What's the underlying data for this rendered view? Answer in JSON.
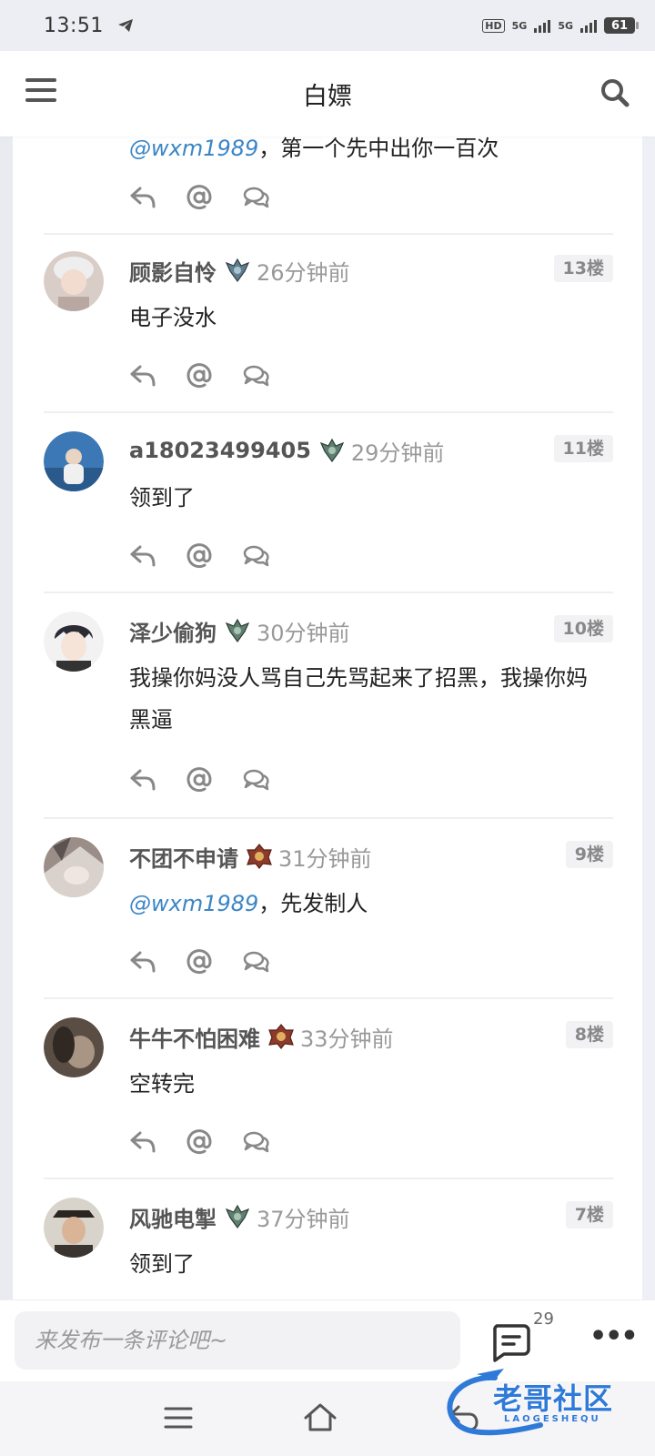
{
  "status_bar": {
    "time": "13:51",
    "hd": "HD",
    "net1": "5G",
    "net2": "5G",
    "battery": "61"
  },
  "header": {
    "title": "白嫖"
  },
  "partial_comment": {
    "mention": "@wxm1989",
    "text": "，第一个先中出你一百次"
  },
  "comments": [
    {
      "username": "顾影自怜",
      "time_ago": "26分钟前",
      "floor": "13楼",
      "content": "电子没水",
      "mention": "",
      "rank_icon": "silver-rank-icon",
      "avatar_color": "#c9b8b0"
    },
    {
      "username": "a18023499405",
      "time_ago": "29分钟前",
      "floor": "11楼",
      "content": "领到了",
      "mention": "",
      "rank_icon": "silver-rank-icon",
      "avatar_color": "#3c78b5"
    },
    {
      "username": "泽少偷狗",
      "time_ago": "30分钟前",
      "floor": "10楼",
      "content": "我操你妈没人骂自己先骂起来了招黑，我操你妈黑逼",
      "mention": "",
      "rank_icon": "silver-rank-icon",
      "avatar_color": "#3b3b44"
    },
    {
      "username": "不团不申请",
      "time_ago": "31分钟前",
      "floor": "9楼",
      "content": "，先发制人",
      "mention": "@wxm1989",
      "rank_icon": "gold-rank-icon",
      "avatar_color": "#8b7d78"
    },
    {
      "username": "牛牛不怕困难",
      "time_ago": "33分钟前",
      "floor": "8楼",
      "content": "空转完",
      "mention": "",
      "rank_icon": "gold-rank-icon",
      "avatar_color": "#6a5c50"
    },
    {
      "username": "风驰电掣",
      "time_ago": "37分钟前",
      "floor": "7楼",
      "content": "领到了",
      "mention": "",
      "rank_icon": "silver-rank-icon",
      "avatar_color": "#4a4038"
    }
  ],
  "bottom_bar": {
    "placeholder": "来发布一条评论吧~",
    "comment_count": "29",
    "more_label": "•••"
  },
  "watermark": {
    "text": "老哥社区",
    "sub": "LAOGESHEQU"
  },
  "colors": {
    "mention": "#3b86c6",
    "username": "#555555",
    "muted": "#999999"
  }
}
